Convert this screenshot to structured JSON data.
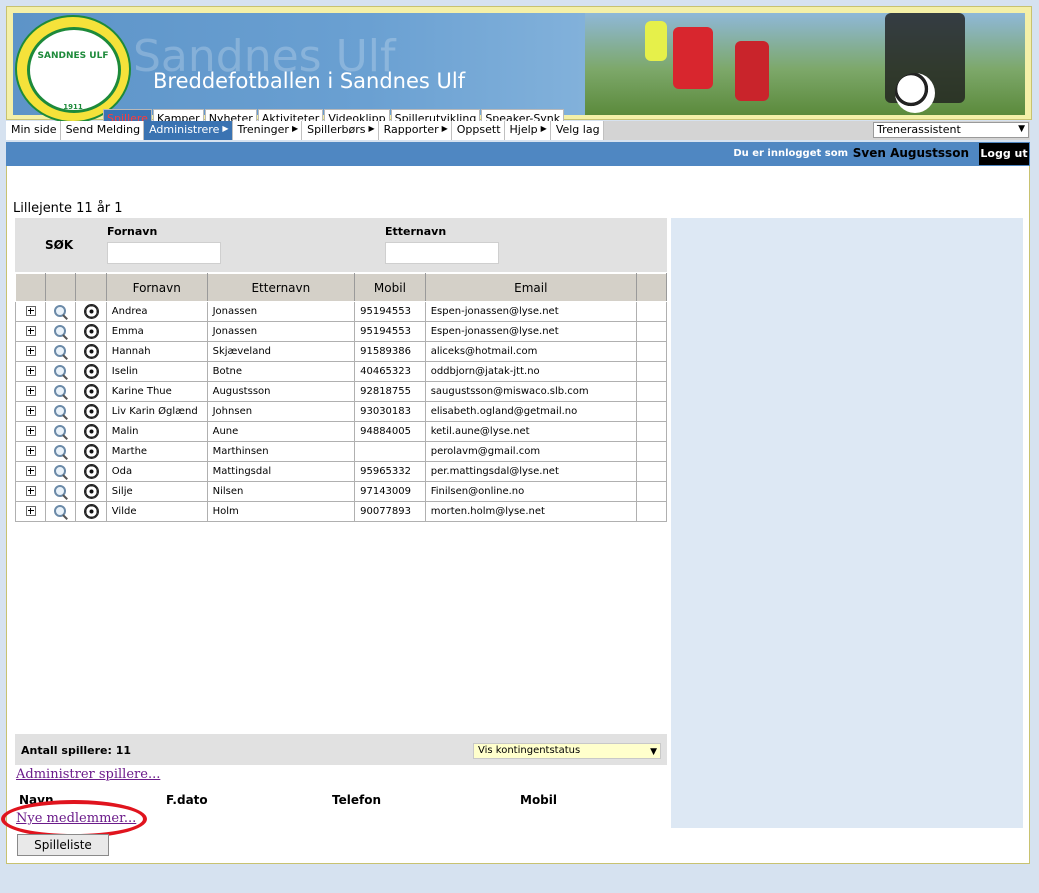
{
  "banner": {
    "ghost_text": "Sandnes Ulf",
    "title": "Breddefotballen i Sandnes Ulf",
    "logo_text": "SANDNES ULF",
    "logo_year": "1911"
  },
  "top_tabs": [
    "Spillere",
    "Kamper",
    "Nyheter",
    "Aktiviteter",
    "Videoklipp",
    "Spillerutvikling",
    "Speaker-Synk"
  ],
  "active_top_tab": "Spillere",
  "menu": [
    {
      "label": "Min side",
      "arrow": false
    },
    {
      "label": "Send Melding",
      "arrow": false
    },
    {
      "label": "Administrere",
      "arrow": true,
      "active": true
    },
    {
      "label": "Treninger",
      "arrow": true
    },
    {
      "label": "Spillerbørs",
      "arrow": true
    },
    {
      "label": "Rapporter",
      "arrow": true
    },
    {
      "label": "Oppsett",
      "arrow": false
    },
    {
      "label": "Hjelp",
      "arrow": true
    },
    {
      "label": "Velg lag",
      "arrow": false
    }
  ],
  "role_select": {
    "value": "Trenerassistent"
  },
  "user": {
    "label": "Du er innlogget som",
    "name": "Sven Augustsson",
    "logout": "Logg ut"
  },
  "team_name": "Lillejente 11 år 1",
  "search": {
    "heading": "SØK",
    "first_name_label": "Fornavn",
    "last_name_label": "Etternavn"
  },
  "table": {
    "columns": [
      "Fornavn",
      "Etternavn",
      "Mobil",
      "Email"
    ],
    "rows": [
      {
        "first": "Andrea",
        "last": "Jonassen",
        "mobile": "95194553",
        "email": "Espen-jonassen@lyse.net"
      },
      {
        "first": "Emma",
        "last": "Jonassen",
        "mobile": "95194553",
        "email": "Espen-jonassen@lyse.net"
      },
      {
        "first": "Hannah",
        "last": "Skjæveland",
        "mobile": "91589386",
        "email": "aliceks@hotmail.com"
      },
      {
        "first": "Iselin",
        "last": "Botne",
        "mobile": "40465323",
        "email": "oddbjorn@jatak-jtt.no"
      },
      {
        "first": "Karine Thue",
        "last": "Augustsson",
        "mobile": "92818755",
        "email": "saugustsson@miswaco.slb.com"
      },
      {
        "first": "Liv Karin Øglænd",
        "last": "Johnsen",
        "mobile": "93030183",
        "email": "elisabeth.ogland@getmail.no"
      },
      {
        "first": "Malin",
        "last": "Aune",
        "mobile": "94884005",
        "email": "ketil.aune@lyse.net"
      },
      {
        "first": "Marthe",
        "last": "Marthinsen",
        "mobile": "",
        "email": "perolavm@gmail.com"
      },
      {
        "first": "Oda",
        "last": "Mattingsdal",
        "mobile": "95965332",
        "email": "per.mattingsdal@lyse.net"
      },
      {
        "first": "Silje",
        "last": "Nilsen",
        "mobile": "97143009",
        "email": "Finilsen@online.no"
      },
      {
        "first": "Vilde",
        "last": "Holm",
        "mobile": "90077893",
        "email": "morten.holm@lyse.net"
      }
    ]
  },
  "footer": {
    "count_label": "Antall spillere: 11",
    "status_select": "Vis kontingentstatus",
    "admin_link": "Administrer spillere...",
    "col_name": "Navn",
    "col_dob": "F.dato",
    "col_phone": "Telefon",
    "col_mobile": "Mobil",
    "new_members_link": "Nye medlemmer...",
    "player_list_button": "Spilleliste"
  },
  "colors": {
    "accent_blue": "#3a73b2",
    "user_bar": "#4f87c2",
    "highlight_red": "#e0141e",
    "link_purple": "#6b1b8a"
  }
}
